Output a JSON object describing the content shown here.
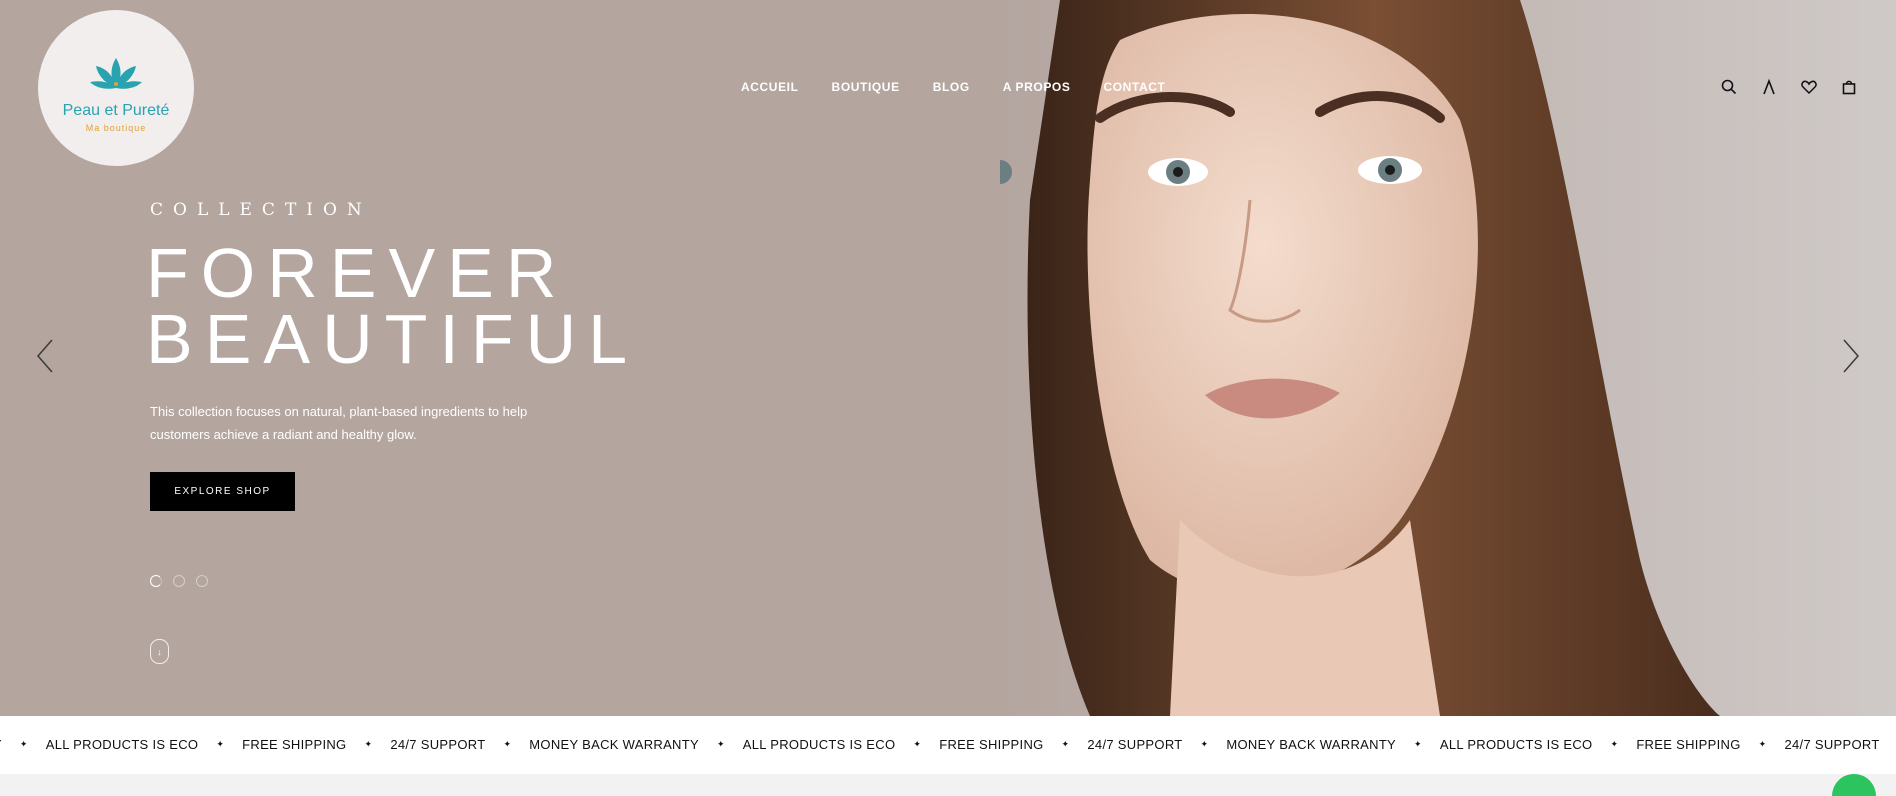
{
  "brand": {
    "name": "Peau et Pureté",
    "tagline": "Ma boutique",
    "teal": "#2aa3b0",
    "gold": "#e0a23a"
  },
  "nav": {
    "items": [
      "ACCUEIL",
      "BOUTIQUE",
      "BLOG",
      "A PROPOS",
      "CONTACT"
    ]
  },
  "header_icons": [
    "search-icon",
    "account-icon",
    "wishlist-icon",
    "cart-icon"
  ],
  "hero": {
    "eyebrow": "COLLECTION",
    "headline_line1": "FOREVER",
    "headline_line2": "BEAUTIFUL",
    "description": "This collection focuses on natural, plant-based ingredients to help customers achieve a radiant and healthy glow.",
    "cta_label": "EXPLORE SHOP",
    "slides_total": 3,
    "active_slide": 1,
    "background": "#b4a59f"
  },
  "ticker": {
    "items": [
      "ANTY",
      "ALL PRODUCTS IS ECO",
      "FREE SHIPPING",
      "24/7 SUPPORT",
      "MONEY BACK WARRANTY",
      "ALL PRODUCTS IS ECO",
      "FREE SHIPPING",
      "24/7 SUPPORT",
      "MONEY BACK WARRANTY",
      "ALL PRODUCTS IS ECO",
      "FREE SHIPPING",
      "24/7 SUPPORT",
      "MONEY BACK WARRANTY"
    ],
    "separator": "✦"
  }
}
